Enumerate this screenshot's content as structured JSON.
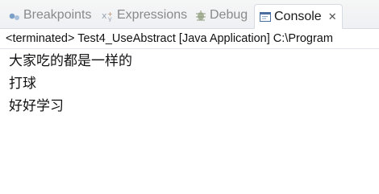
{
  "tabs": [
    {
      "label": "Breakpoints",
      "icon": "breakpoints-icon"
    },
    {
      "label": "Expressions",
      "icon": "expressions-icon"
    },
    {
      "label": "Debug",
      "icon": "debug-icon"
    },
    {
      "label": "Console",
      "icon": "console-icon",
      "active": true
    }
  ],
  "console": {
    "status": "<terminated> Test4_UseAbstract [Java Application] C:\\Program",
    "lines": [
      "大家吃的都是一样的",
      "打球",
      "好好学习"
    ]
  },
  "colors": {
    "inactive_tab_text": "#8a8a8a",
    "active_tab_text": "#1a1a1a",
    "tabbar_bg": "#eef0f3",
    "console_bg": "#ffffff"
  }
}
